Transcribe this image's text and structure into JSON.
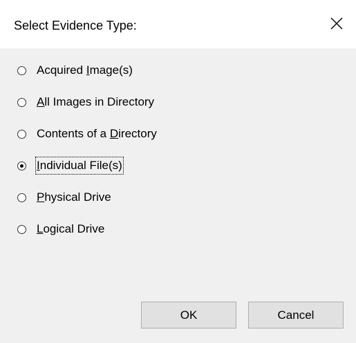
{
  "dialog": {
    "title": "Select Evidence Type:",
    "close_icon": "close-icon"
  },
  "options": [
    {
      "pre": "Acquired ",
      "mnemonic": "I",
      "post": "mage(s)",
      "checked": false
    },
    {
      "pre": "",
      "mnemonic": "A",
      "post": "ll Images in Directory",
      "checked": false
    },
    {
      "pre": "Contents of a ",
      "mnemonic": "D",
      "post": "irectory",
      "checked": false
    },
    {
      "pre": "",
      "mnemonic": "I",
      "post": "ndividual File(s)",
      "checked": true,
      "focused": true
    },
    {
      "pre": "",
      "mnemonic": "P",
      "post": "hysical Drive",
      "checked": false
    },
    {
      "pre": "",
      "mnemonic": "L",
      "post": "ogical Drive",
      "checked": false
    }
  ],
  "buttons": {
    "ok_label": "OK",
    "cancel_label": "Cancel"
  }
}
